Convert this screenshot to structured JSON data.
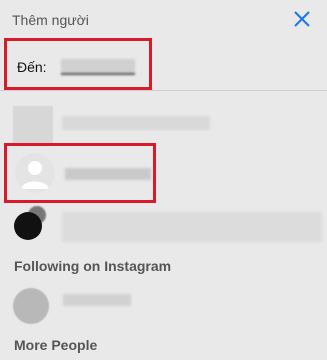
{
  "header": {
    "title": "Thêm người",
    "close_icon": "close-icon"
  },
  "to_field": {
    "label": "Đến:"
  },
  "sections": {
    "following_instagram": "Following on Instagram",
    "more_people": "More People"
  },
  "colors": {
    "accent": "#1877f2",
    "highlight_border": "#d81b2a"
  }
}
